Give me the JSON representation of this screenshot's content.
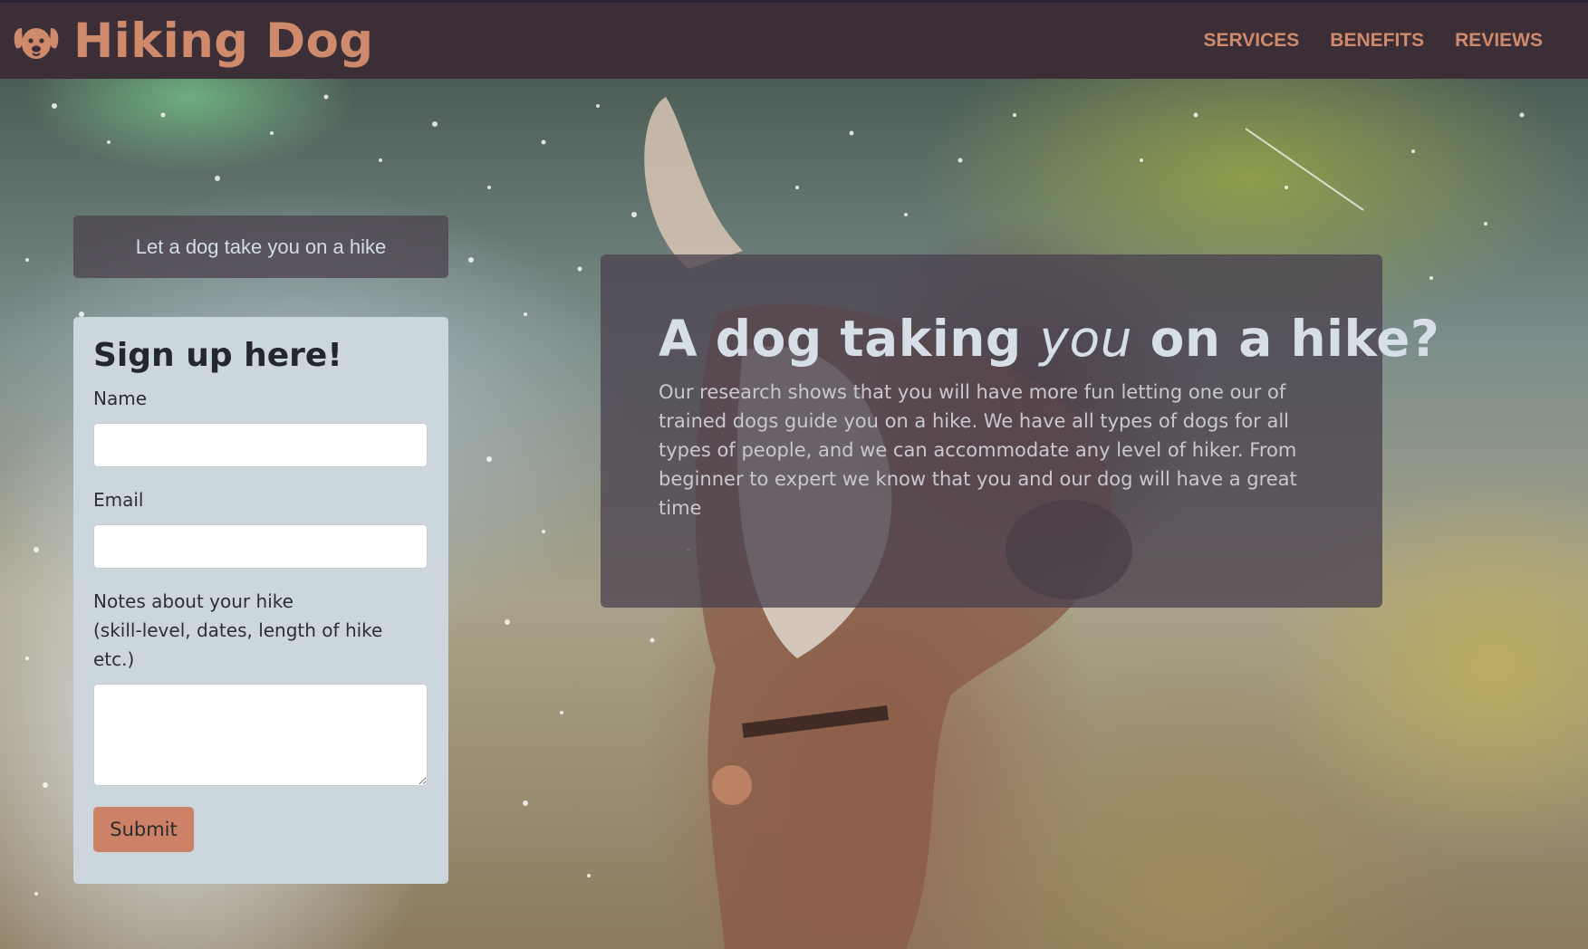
{
  "brand": {
    "name": "Hiking Dog",
    "icon": "dog-face-icon"
  },
  "nav": {
    "links": [
      "SERVICES",
      "BENEFITS",
      "REVIEWS"
    ]
  },
  "hero": {
    "tagline": "Let a dog take you on a hike"
  },
  "signup": {
    "title": "Sign up here!",
    "name_label": "Name",
    "name_value": "",
    "email_label": "Email",
    "email_value": "",
    "notes_label_line1": "Notes about your hike",
    "notes_label_line2": "(skill-level, dates, length of hike etc.)",
    "notes_value": "",
    "submit_label": "Submit"
  },
  "info": {
    "title_before": "A dog taking",
    "title_emphasis": "you",
    "title_after": "on a hike?",
    "body": "Our research shows that you will have more fun letting one our of trained dogs guide you on a hike. We have all types of dogs for all types of people, and we can accommodate any level of hiker. From beginner to expert we know that you and our dog will have a great time"
  },
  "colors": {
    "navbar_bg": "#3c2e36",
    "accent": "#cf8a6c",
    "form_bg": "#ccd6dd",
    "button_bg": "#cd8268",
    "overlay": "#4c4250"
  }
}
